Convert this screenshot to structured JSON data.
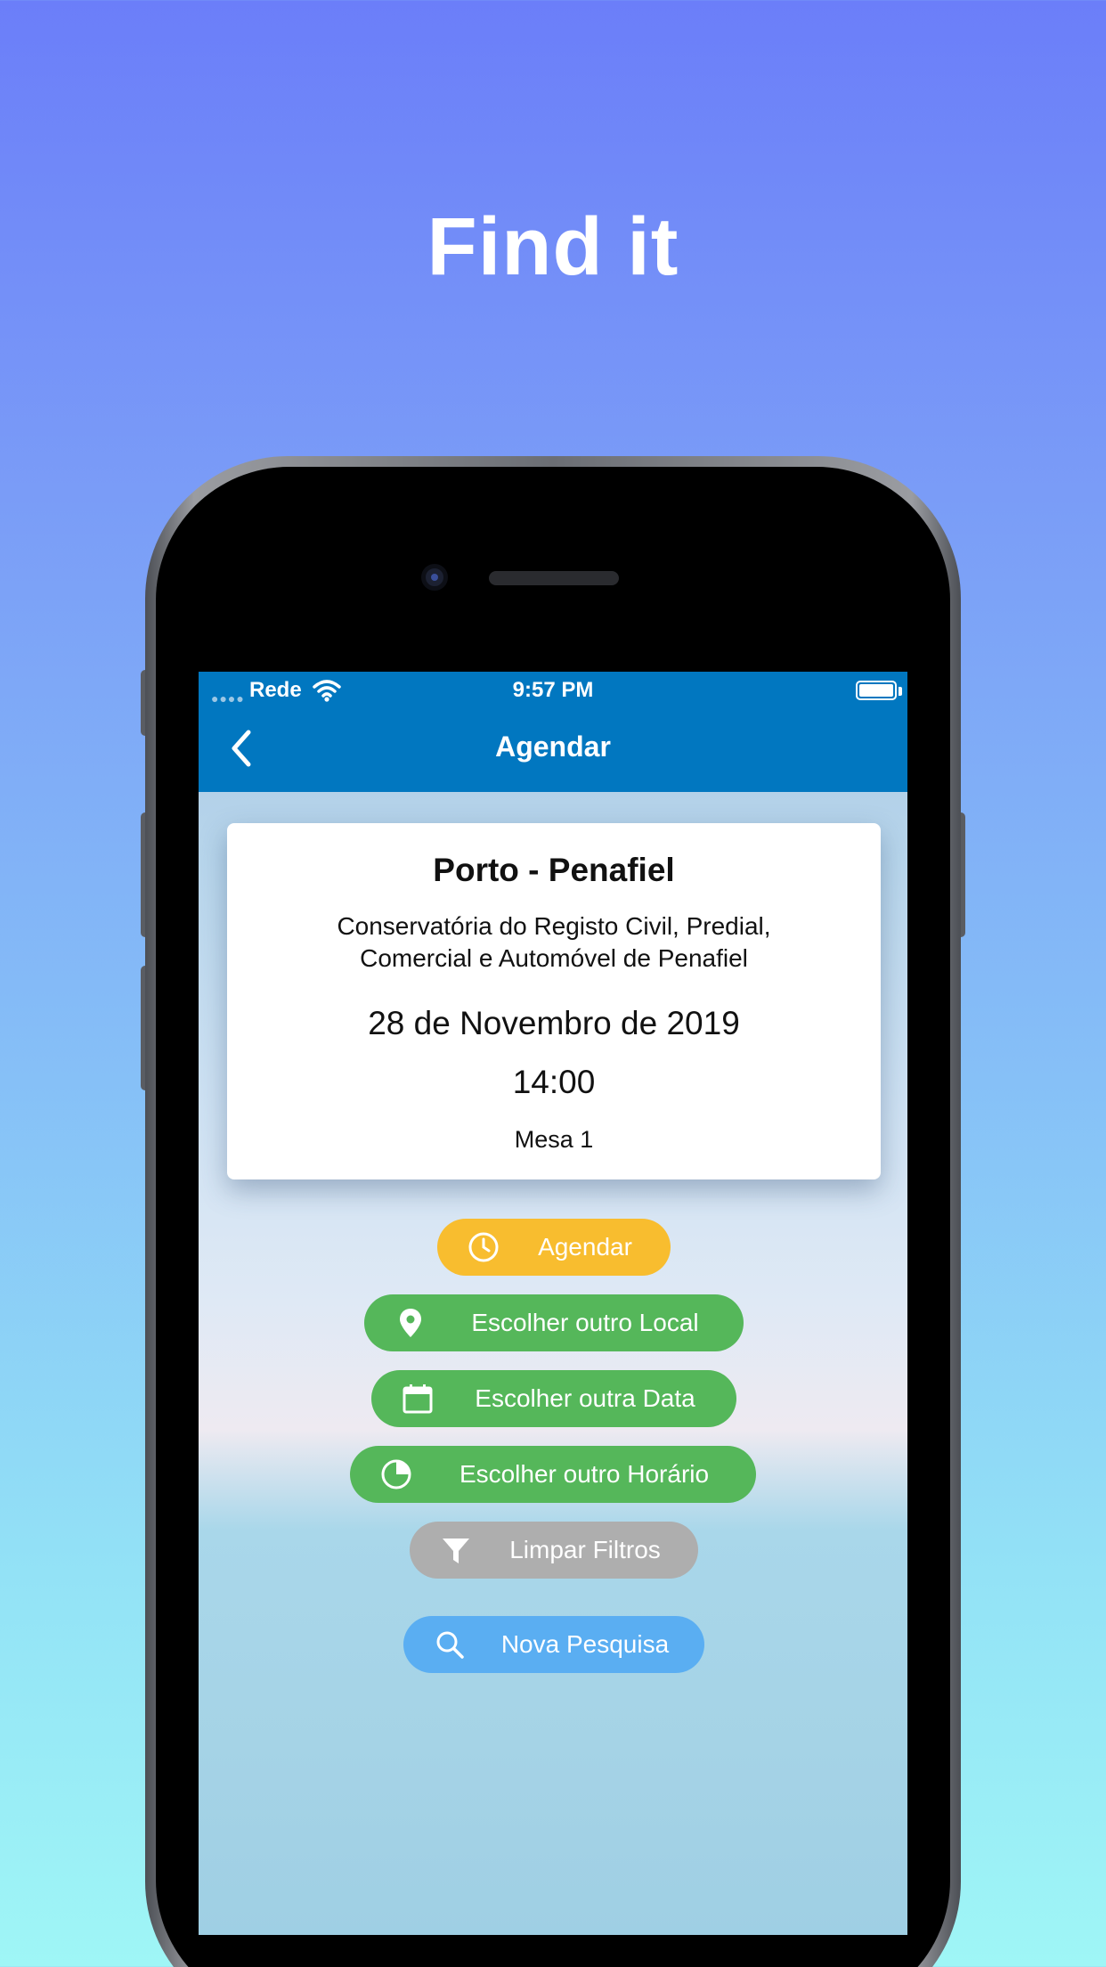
{
  "headline": "Find it",
  "status_bar": {
    "signal": "●●●●",
    "carrier": "Rede",
    "time": "9:57 PM"
  },
  "nav": {
    "title": "Agendar"
  },
  "card": {
    "title": "Porto - Penafiel",
    "description": "Conservatória do Registo Civil, Predial, Comercial e Automóvel de Penafiel",
    "date": "28 de Novembro de 2019",
    "time": "14:00",
    "desk": "Mesa 1"
  },
  "buttons": {
    "schedule": {
      "label": "Agendar",
      "icon": "clock-icon",
      "color": "#f8bd2f"
    },
    "choose_location": {
      "label": "Escolher outro Local",
      "icon": "location-pin-icon",
      "color": "#55b75a"
    },
    "choose_date": {
      "label": "Escolher outra Data",
      "icon": "calendar-icon",
      "color": "#55b75a"
    },
    "choose_time": {
      "label": "Escolher outro Horário",
      "icon": "pie-chart-icon",
      "color": "#55b75a"
    },
    "clear_filters": {
      "label": "Limpar Filtros",
      "icon": "filter-icon",
      "color": "#aeaeae"
    },
    "new_search": {
      "label": "Nova Pesquisa",
      "icon": "search-icon",
      "color": "#5aaef2"
    }
  },
  "colors": {
    "nav_bar": "#0177c0"
  }
}
